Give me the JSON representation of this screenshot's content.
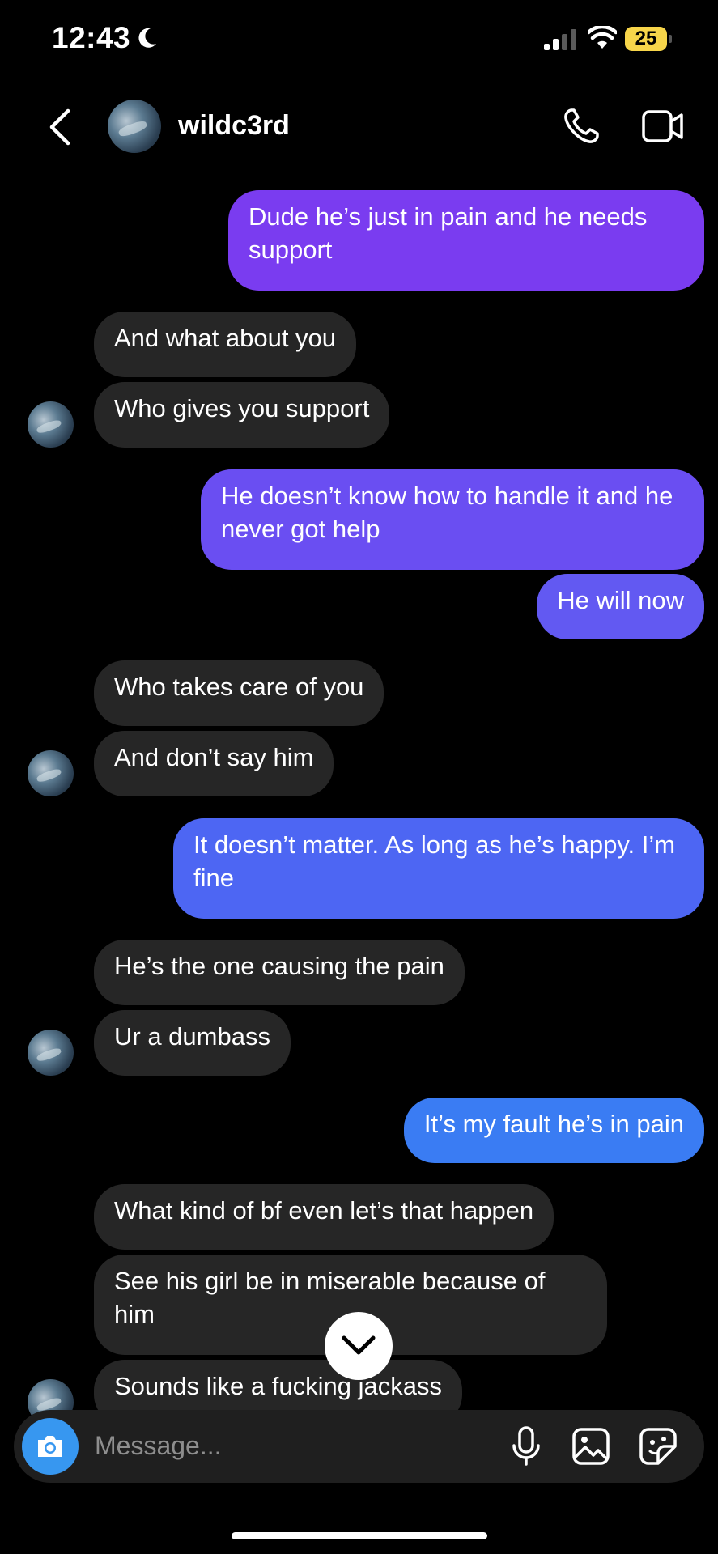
{
  "status": {
    "time": "12:43",
    "battery": "25"
  },
  "header": {
    "username": "wildc3rd"
  },
  "messages": [
    {
      "dir": "sent",
      "text": "Dude he’s just in pain and he needs support"
    },
    {
      "dir": "recv",
      "text": "And what about you"
    },
    {
      "dir": "recv",
      "text": "Who gives you support"
    },
    {
      "dir": "sent",
      "text": "He doesn’t know how to handle it and he never got help"
    },
    {
      "dir": "sent",
      "text": "He will now"
    },
    {
      "dir": "recv",
      "text": "Who takes care of you"
    },
    {
      "dir": "recv",
      "text": "And don’t say him"
    },
    {
      "dir": "sent",
      "text": "It doesn’t matter. As long as he’s happy. I’m fine"
    },
    {
      "dir": "recv",
      "text": "He’s the one causing the pain"
    },
    {
      "dir": "recv",
      "text": "Ur a dumbass"
    },
    {
      "dir": "sent",
      "text": "It’s my fault he’s in pain"
    },
    {
      "dir": "recv",
      "text": "What kind of bf even let’s that happen"
    },
    {
      "dir": "recv",
      "text": "See his girl be in miserable because of him"
    },
    {
      "dir": "recv",
      "text": "Sounds like a fucking jackass"
    }
  ],
  "composer": {
    "placeholder": "Message..."
  },
  "icons": {
    "back": "chevron-left-icon",
    "call": "phone-icon",
    "video": "video-camera-icon",
    "scroll": "chevron-down-icon",
    "camera": "camera-icon",
    "mic": "microphone-icon",
    "gallery": "image-icon",
    "sticker": "sticker-icon"
  },
  "colors": {
    "background": "#000000",
    "received_bubble": "#262626",
    "sent_gradient_top": "#7a3cf0",
    "sent_gradient_bottom": "#3a7cf3",
    "camera_button": "#3797f0",
    "battery": "#f7d54a"
  }
}
